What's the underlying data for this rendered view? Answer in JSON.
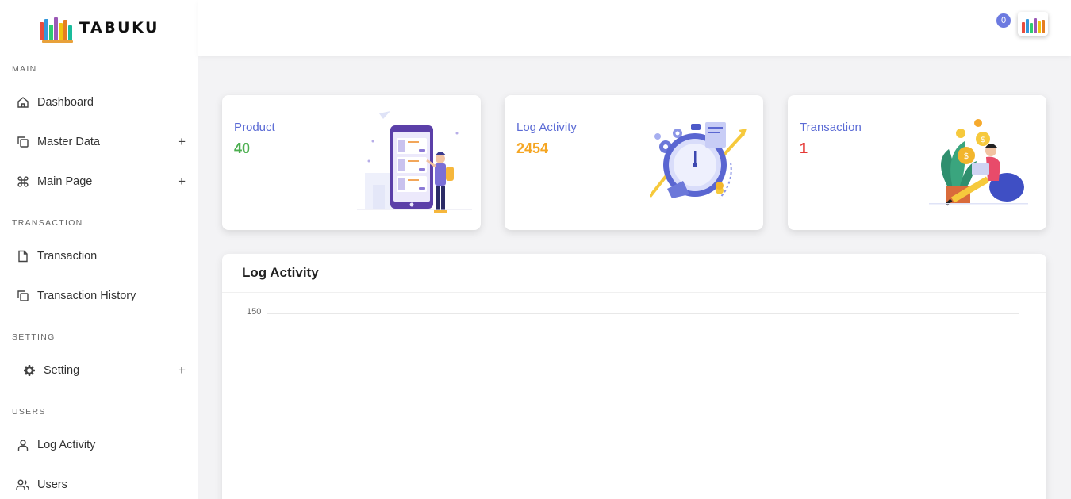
{
  "brand": {
    "name": "TABUKU"
  },
  "sidebar": {
    "sections": {
      "main": "MAIN",
      "transaction": "TRANSACTION",
      "setting": "SETTING",
      "users": "USERS"
    },
    "items": {
      "dashboard": "Dashboard",
      "master_data": "Master Data",
      "main_page": "Main Page",
      "transaction": "Transaction",
      "transaction_history": "Transaction History",
      "setting": "Setting",
      "log_activity": "Log Activity",
      "users": "Users"
    },
    "expand_symbol": "+"
  },
  "topbar": {
    "notification_count": "0"
  },
  "cards": [
    {
      "title": "Product",
      "value": "40",
      "value_color": "#4caf50",
      "icon": "phone-shopping-illustration"
    },
    {
      "title": "Log Activity",
      "value": "2454",
      "value_color": "#f5a623",
      "icon": "stopwatch-illustration"
    },
    {
      "title": "Transaction",
      "value": "1",
      "value_color": "#e53935",
      "icon": "coins-illustration"
    }
  ],
  "log_panel": {
    "title": "Log Activity"
  },
  "chart_data": {
    "type": "line",
    "title": "Log Activity",
    "y_ticks": [
      "150"
    ],
    "series": []
  },
  "colors": {
    "accent": "#5b6bd5",
    "badge": "#6c7ae0"
  }
}
